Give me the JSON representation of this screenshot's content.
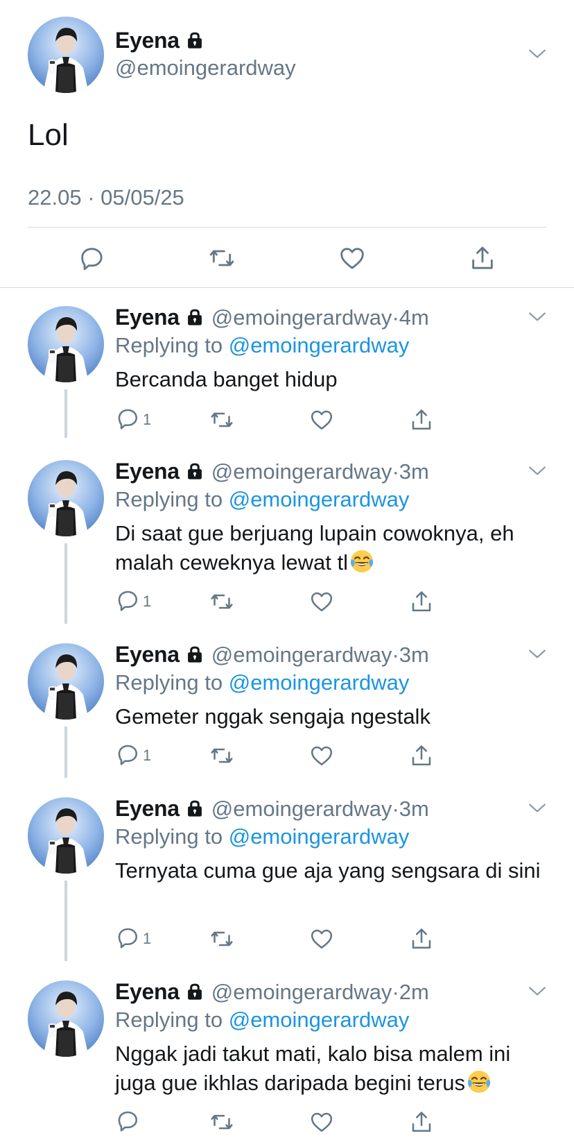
{
  "colors": {
    "text": "#14171a",
    "secondary": "#657786",
    "link": "#1b95e0",
    "divider": "#d6dadd",
    "thread": "#ccd6dd"
  },
  "main_tweet": {
    "name": "Eyena",
    "handle": "@emoingerardway",
    "text": "Lol",
    "meta": "22.05 · 05/05/25",
    "icons": [
      "reply-icon",
      "retweet-icon",
      "like-icon",
      "share-icon"
    ]
  },
  "replies": [
    {
      "name": "Eyena",
      "handle": "@emoingerardway",
      "time": "·4m",
      "replying_label": "Replying to",
      "replying_to": "@emoingerardway",
      "text": "Bercanda banget hidup",
      "reply_count": "1"
    },
    {
      "name": "Eyena",
      "handle": "@emoingerardway",
      "time": "·3m",
      "replying_label": "Replying to",
      "replying_to": "@emoingerardway",
      "text": "Di saat gue berjuang lupain cowoknya, eh malah ceweknya lewat tl",
      "emoji": "face-with-tears-of-joy",
      "reply_count": "1"
    },
    {
      "name": "Eyena",
      "handle": "@emoingerardway",
      "time": "·3m",
      "replying_label": "Replying to",
      "replying_to": "@emoingerardway",
      "text": "Gemeter nggak sengaja ngestalk",
      "reply_count": "1"
    },
    {
      "name": "Eyena",
      "handle": "@emoingerardway",
      "time": "·3m",
      "replying_label": "Replying to",
      "replying_to": "@emoingerardway",
      "text": "Ternyata cuma gue aja yang sengsara di sini",
      "reply_count": "1"
    },
    {
      "name": "Eyena",
      "handle": "@emoingerardway",
      "time": "·2m",
      "replying_label": "Replying to",
      "replying_to": "@emoingerardway",
      "text": "Nggak jadi takut mati, kalo bisa malem ini juga gue ikhlas daripada begini terus",
      "emoji": "face-with-tears-of-joy",
      "reply_count": ""
    }
  ]
}
